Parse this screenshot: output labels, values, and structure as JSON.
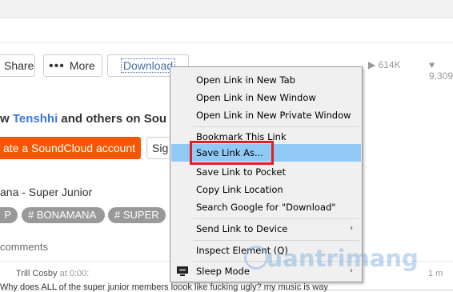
{
  "toolbar": {
    "share_label": "Share",
    "more_label": "More",
    "download_label": "Download",
    "plays": "614K",
    "likes": "9,309"
  },
  "follow": {
    "prefix": "w ",
    "user": "Tenshhi",
    "suffix": " and others on Sou",
    "create_label": "ate a SoundCloud account",
    "sign_label": "Sig"
  },
  "track": {
    "title": "ana - Super Junior",
    "tags": [
      "P",
      "# BONAMANA",
      "# SUPER"
    ]
  },
  "comments": {
    "count_label": "comments",
    "author": "Trill Cosby",
    "at_label": " at ",
    "timestamp": "0:00",
    "colon": ":",
    "body": "Why does ALL of the super junior members loook like fucking ugly? my music is way",
    "index": "1 m"
  },
  "menu": {
    "items": [
      "Open Link in New Tab",
      "Open Link in New Window",
      "Open Link in New Private Window",
      "Bookmark This Link",
      "Save Link As...",
      "Save Link to Pocket",
      "Copy Link Location",
      "Search Google for \"Download\"",
      "Send Link to Device",
      "Inspect Element (Q)",
      "Sleep Mode"
    ],
    "submenu_arrow": "›"
  },
  "watermark": {
    "text": "uantrimang"
  },
  "colors": {
    "accent_orange": "#f55700",
    "menu_highlight": "#91c9f7",
    "annotation_red": "#e01e26",
    "link_blue": "#3a7ad8"
  }
}
